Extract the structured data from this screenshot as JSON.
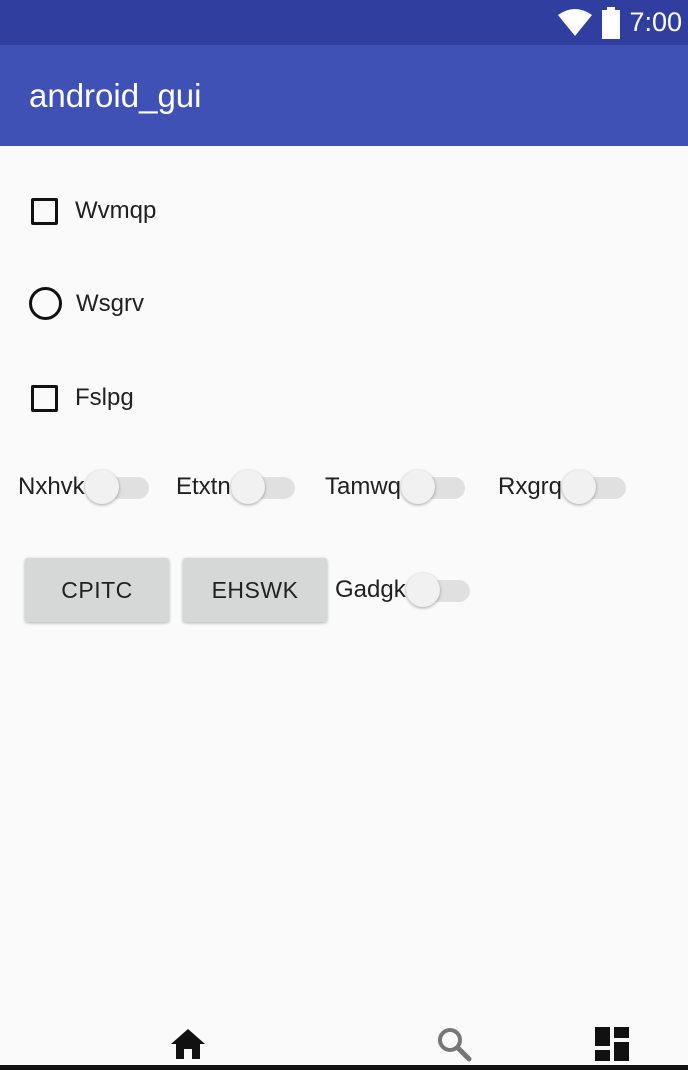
{
  "status_bar": {
    "time": "7:00",
    "icons": [
      "wifi-icon",
      "battery-icon"
    ]
  },
  "app_bar": {
    "title": "android_gui"
  },
  "checkboxes": [
    {
      "label": "Wvmqp",
      "checked": false
    },
    {
      "label": "Fslpg",
      "checked": false
    }
  ],
  "radio": {
    "label": "Wsgrv",
    "selected": false
  },
  "switches_row": [
    {
      "label": "Nxhvk",
      "on": false
    },
    {
      "label": "Etxtn",
      "on": false
    },
    {
      "label": "Tamwq",
      "on": false
    },
    {
      "label": "Rxgrq",
      "on": false
    }
  ],
  "buttons": [
    {
      "label": "CPITC"
    },
    {
      "label": "EHSWK"
    }
  ],
  "switch_gadgk": {
    "label": "Gadgk",
    "on": false
  },
  "bottom_nav": {
    "icons": [
      "home-icon",
      "search-icon",
      "dashboard-icon"
    ]
  },
  "colors": {
    "status_bar": "#303f9f",
    "app_bar": "#3f51b5",
    "background": "#fafafa"
  }
}
